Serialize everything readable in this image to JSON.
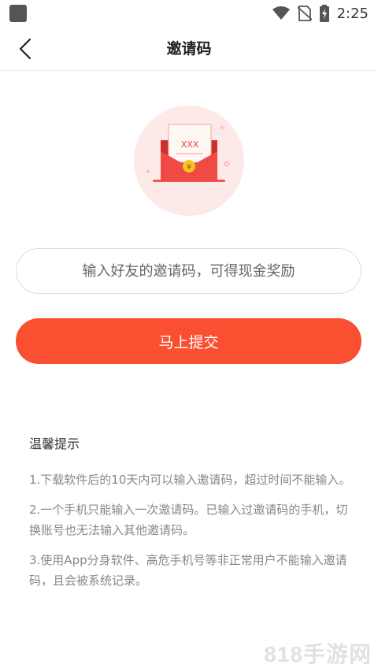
{
  "status_bar": {
    "time": "2:25"
  },
  "nav": {
    "title": "邀请码",
    "back_icon": "chevron-left-icon"
  },
  "illustration": {
    "code_text": "XXX",
    "currency_symbol": "¥"
  },
  "invite_input": {
    "placeholder": "输入好友的邀请码，可得现金奖励",
    "value": ""
  },
  "submit": {
    "label": "马上提交"
  },
  "tips": {
    "title": "温馨提示",
    "items": [
      "1.下载软件后的10天内可以输入邀请码，超过时间不能输入。",
      "2.一个手机只能输入一次邀请码。已输入过邀请码的手机，切换账号也无法输入其他邀请码。",
      "3.使用App分身软件、高危手机号等非正常用户不能输入邀请码，且会被系统记录。"
    ]
  },
  "watermark": "818手游网",
  "colors": {
    "accent": "#fb4f32",
    "envelope": "#f04a44",
    "coin": "#f7c71f"
  }
}
